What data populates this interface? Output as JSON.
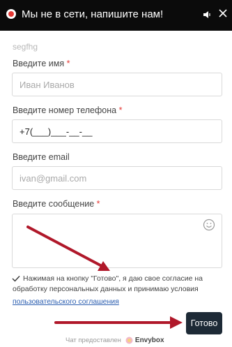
{
  "header": {
    "title": "Мы не в сети, напишите нам!",
    "status_icon": "offline-dot-icon",
    "sound_icon": "speaker-icon",
    "close_icon": "close-icon"
  },
  "form": {
    "company": "segfhg",
    "name_label": "Введите имя",
    "name_placeholder": "Иван Иванов",
    "phone_label": "Введите номер телефона",
    "phone_value": "+7(___)___-__-__",
    "email_label": "Введите email",
    "email_placeholder": "ivan@gmail.com",
    "message_label": "Введите сообщение",
    "message_value": "",
    "required_mark": "*"
  },
  "consent": {
    "text_line1": "Нажимая на кнопку \"Готово\", я даю свое согласие на",
    "text_line2": "обработку персональных данных и принимаю условия",
    "link": "пользовательского соглашения",
    "checked": true
  },
  "submit_label": "Готово",
  "footer": {
    "prefix": "Чат предоставлен",
    "brand": "Envybox"
  },
  "colors": {
    "header_bg": "#0b0b0b",
    "required": "#e53935",
    "button_bg": "#1d2a36",
    "link": "#2a5db0",
    "arrow": "#b0182a"
  }
}
